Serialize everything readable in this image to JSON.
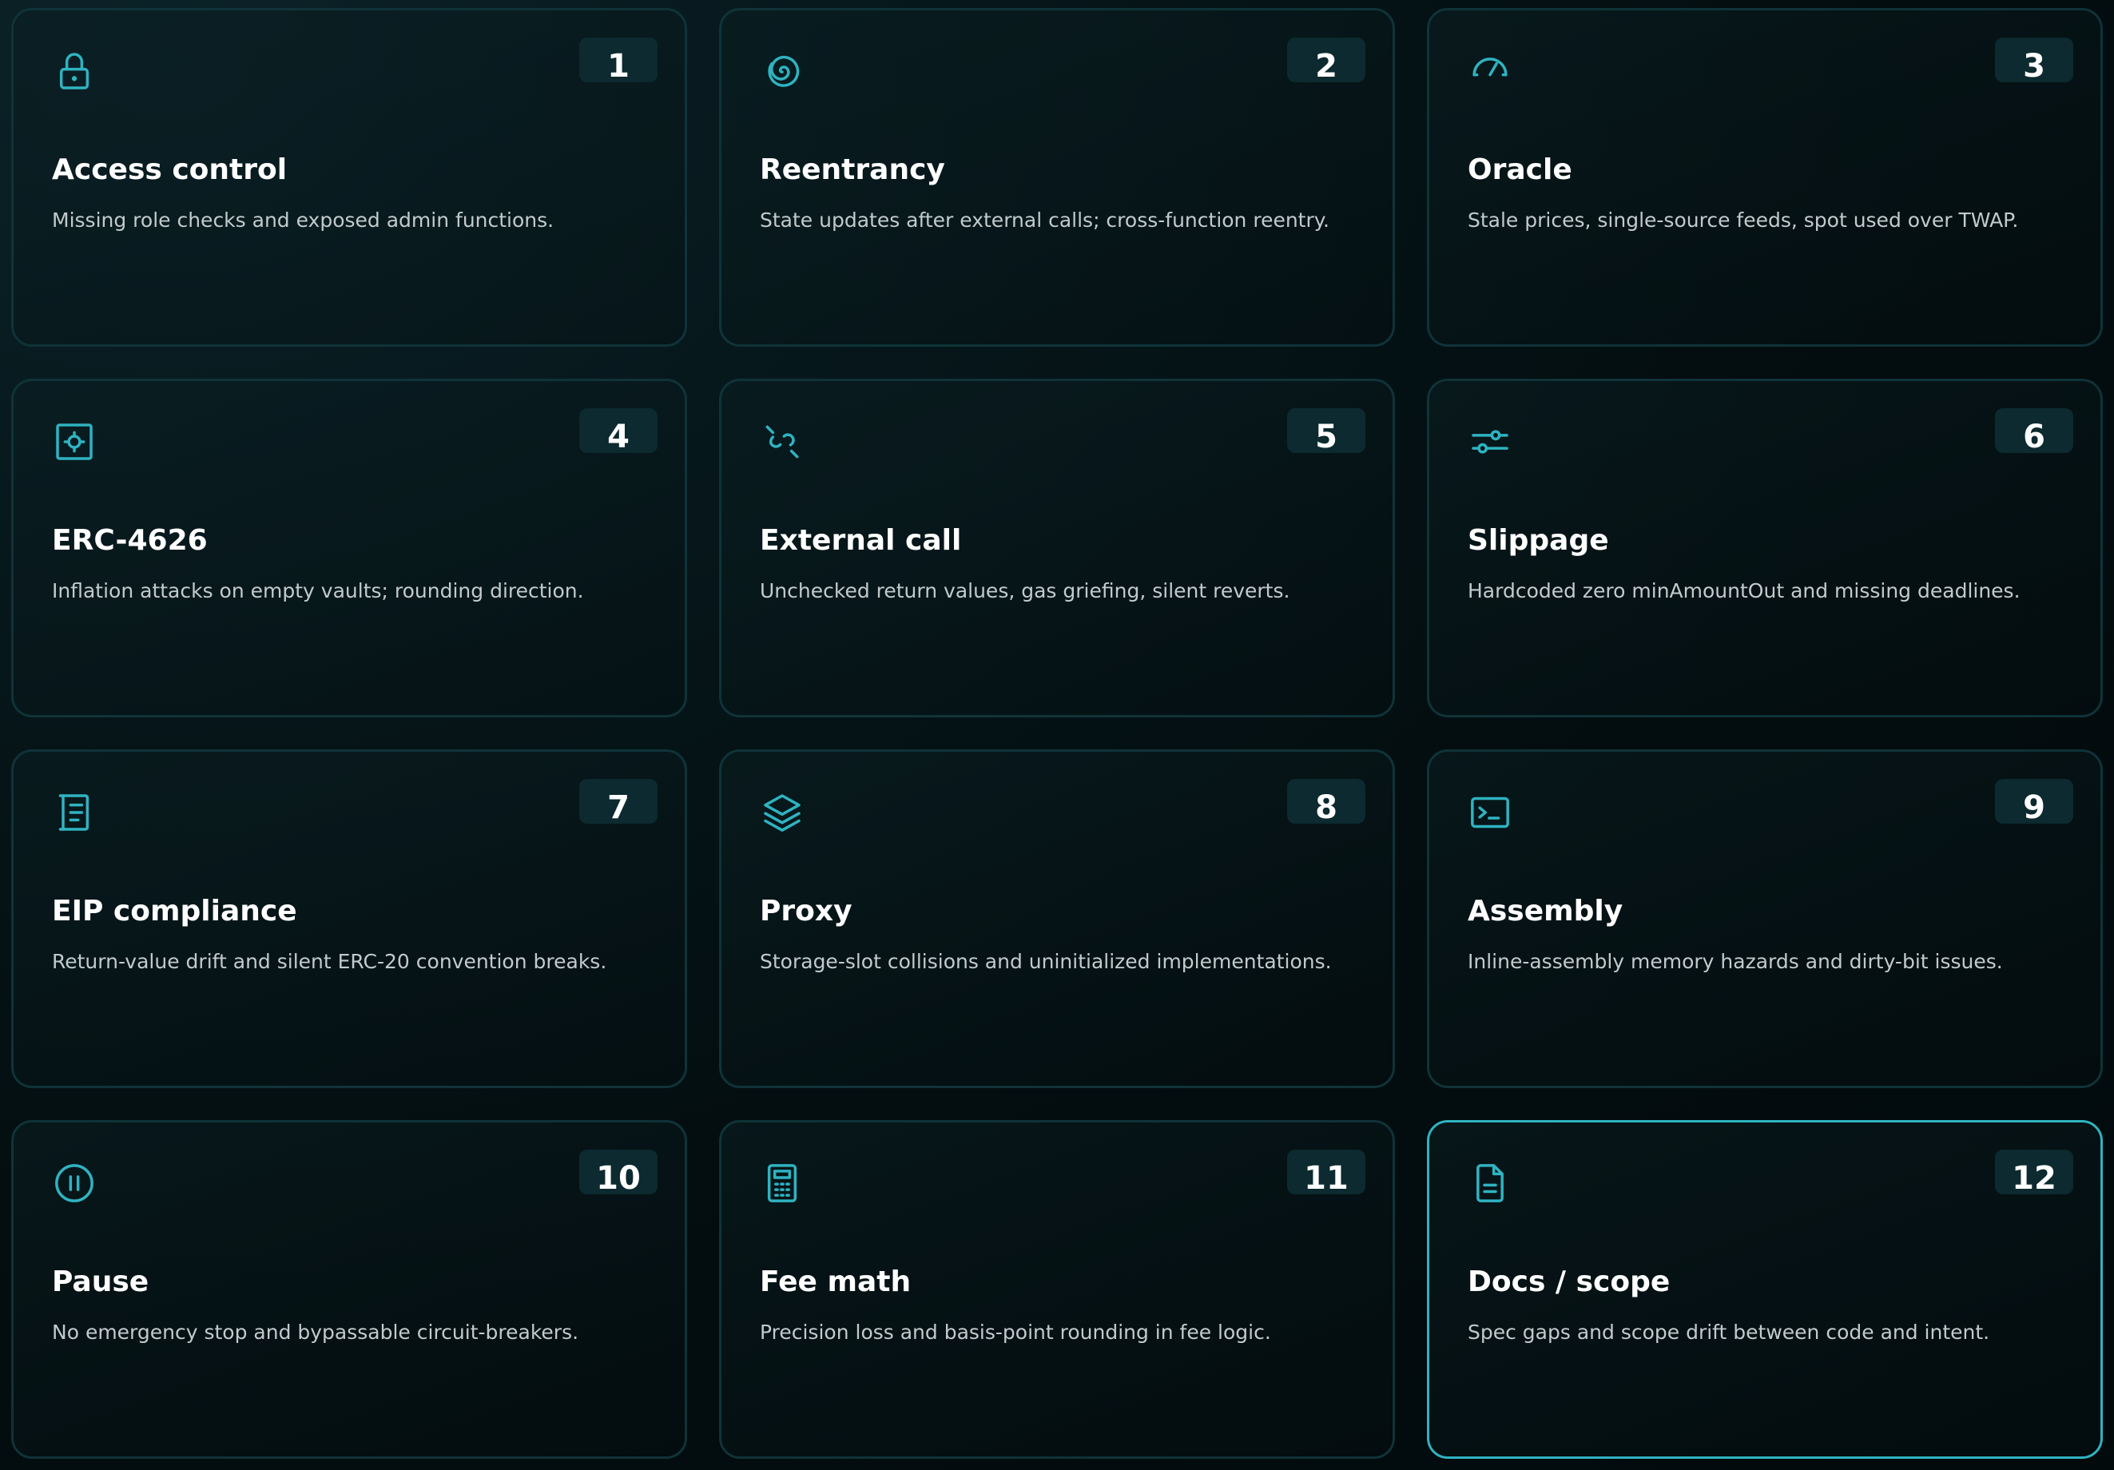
{
  "colors": {
    "accent": "#2fb3c1",
    "background": "#030c0e",
    "card_border": "#0f3338",
    "badge_bg": "#0c2a2f",
    "title": "#ffffff",
    "description": "#c2cacc"
  },
  "cards": [
    {
      "number": "1",
      "title": "Access control",
      "description": "Missing role checks and exposed admin functions.",
      "icon": "lock-icon"
    },
    {
      "number": "2",
      "title": "Reentrancy",
      "description": "State updates after external calls; cross-function reentry.",
      "icon": "spiral-icon"
    },
    {
      "number": "3",
      "title": "Oracle",
      "description": "Stale prices, single-source feeds, spot used over TWAP.",
      "icon": "gauge-icon"
    },
    {
      "number": "4",
      "title": "ERC-4626",
      "description": "Inflation attacks on empty vaults; rounding direction.",
      "icon": "vault-icon"
    },
    {
      "number": "5",
      "title": "External call",
      "description": "Unchecked return values, gas griefing, silent reverts.",
      "icon": "unlink-icon"
    },
    {
      "number": "6",
      "title": "Slippage",
      "description": "Hardcoded zero minAmountOut and missing deadlines.",
      "icon": "sliders-icon"
    },
    {
      "number": "7",
      "title": "EIP compliance",
      "description": "Return-value drift and silent ERC-20 convention breaks.",
      "icon": "scroll-icon"
    },
    {
      "number": "8",
      "title": "Proxy",
      "description": "Storage-slot collisions and uninitialized implementations.",
      "icon": "layers-icon"
    },
    {
      "number": "9",
      "title": "Assembly",
      "description": "Inline-assembly memory hazards and dirty-bit issues.",
      "icon": "terminal-icon"
    },
    {
      "number": "10",
      "title": "Pause",
      "description": "No emergency stop and bypassable circuit-breakers.",
      "icon": "pause-icon"
    },
    {
      "number": "11",
      "title": "Fee math",
      "description": "Precision loss and basis-point rounding in fee logic.",
      "icon": "calculator-icon"
    },
    {
      "number": "12",
      "title": "Docs / scope",
      "description": "Spec gaps and scope drift between code and intent.",
      "icon": "document-icon"
    }
  ],
  "active_card": 12
}
